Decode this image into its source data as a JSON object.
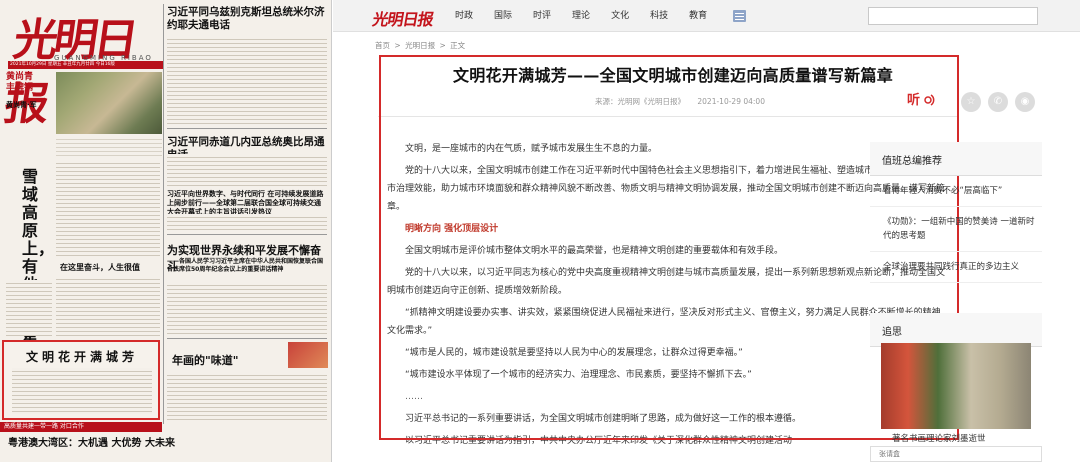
{
  "newspaper": {
    "logo": "光明日报",
    "pinyin": "GUANGMING RIBAO",
    "dateline": "2021年10月29日 星期五 辛丑年九月廿四 今日16版",
    "side_red_1": "黄尚青",
    "side_red_2": "丰碑钢",
    "side_text": "黄尚青·军",
    "big_title": "雪域高原上，有他们的星辰大海",
    "headline_1": "习近平同乌兹别克斯坦总统米尔济约耶夫通电话",
    "headline_2": "习近平同赤道几内亚总统奥比昂通电话",
    "headline_3": "习近平向世界数字、与时代同行 在可持续发展道路上阔步前行——全球第二届联合国全球可持续交通大会开幕式上的主旨讲话引发热议",
    "headline_4": "为实现世界永续和平发展不懈奋斗",
    "headline_4_sub": "——各国人民学习习近平主席在中华人民共和国恢复联合国合法席位50周年纪念会议上的重要讲话精神",
    "headline_5": "在这里奋斗，人生很值",
    "box_title": "文明花开满城芳",
    "nianhua_title": "年画的\"味道\"",
    "footer_red": "高质量共建一带一路 对口合作",
    "footer_title": "粤港澳大湾区：大机遇 大优势 大未来"
  },
  "site": {
    "logo": "光明日报",
    "nav": [
      "时政",
      "国际",
      "时评",
      "理论",
      "文化",
      "科技",
      "教育"
    ],
    "search_placeholder": ""
  },
  "breadcrumb": [
    "首页",
    ">",
    "光明日报",
    ">",
    "正文"
  ],
  "article": {
    "title": "文明花开满城芳——全国文明城市创建迈向高质量谱写新篇章",
    "source": "来源：光明网《光明日报》",
    "date": "2021-10-29 04:00",
    "listen_label": "听",
    "paragraphs": [
      "文明，是一座城市的内在气质，赋予城市发展生生不息的力量。",
      "党的十八大以来，全国文明城市创建工作在习近平新时代中国特色社会主义思想指引下，着力增进民生福祉、塑造城市人文魅力、提升城市治理效能，助力城市环境面貌和群众精神风貌不断改善、物质文明与精神文明协调发展，推动全国文明城市创建不断迈向高质量、谱写新篇章。",
      "明晰方向 强化顶层设计",
      "全国文明城市是评价城市整体文明水平的最高荣誉，也是精神文明创建的重要载体和有效手段。",
      "党的十八大以来，以习近平同志为核心的党中央高度重视精神文明创建与城市高质量发展，提出一系列新思想新观点新论断，推动全国文明城市创建迈向守正创新、提质增效新阶段。",
      "“抓精神文明建设要办实事、讲实效，紧紧围绕促进人民福祉来进行，坚决反对形式主义、官僚主义，努力满足人民群众不断增长的精神文化需求。”",
      "“城市是人民的，城市建设就是要坚持以人民为中心的发展理念，让群众过得更幸福。”",
      "“城市建设水平体现了一个城市的经济实力、治理理念、市民素质，要坚持不懈抓下去。”",
      "……",
      "习近平总书记的一系列重要讲话，为全国文明城市创建明晰了思路，成为做好这一工作的根本遵循。",
      "以习近平总书记重要讲话为指引，中共中央办公厅近年来印发《关于深化群众性精神文明创建活动"
    ]
  },
  "share": [
    "☆",
    "✆",
    "◉"
  ],
  "sidebar": {
    "recommend_title": "值班总编推荐",
    "recommend_items": [
      "看待年轻人消费不必“层高临下”",
      "《功勋》：一组新中国的赞美诗 一道新时代的思考题",
      "全球治理要共同践行真正的多边主义"
    ],
    "memorial_title": "追思",
    "memorial_caption": "著名书画理论家刘墨逝世",
    "search_placeholder": "张请盒"
  }
}
